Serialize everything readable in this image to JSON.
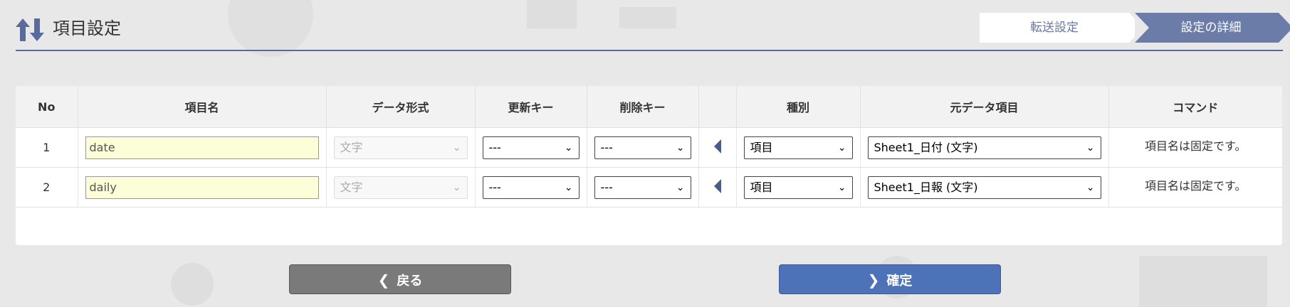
{
  "header": {
    "title": "項目設定",
    "steps": [
      "転送設定",
      "設定の詳細"
    ]
  },
  "table": {
    "columns": [
      "No",
      "項目名",
      "データ形式",
      "更新キー",
      "削除キー",
      "",
      "種別",
      "元データ項目",
      "コマンド"
    ],
    "rows": [
      {
        "no": "1",
        "name": "date",
        "format": "文字",
        "update_key": "---",
        "delete_key": "---",
        "kind": "項目",
        "source": "Sheet1_日付 (文字)",
        "command": "項目名は固定です。"
      },
      {
        "no": "2",
        "name": "daily",
        "format": "文字",
        "update_key": "---",
        "delete_key": "---",
        "kind": "項目",
        "source": "Sheet1_日報 (文字)",
        "command": "項目名は固定です。"
      }
    ]
  },
  "buttons": {
    "back": "戻る",
    "confirm": "確定"
  },
  "colors": {
    "accent": "#6c7ca8",
    "confirm": "#4e72b8",
    "back": "#7a7a7a",
    "input_bg": "#fdfdd8"
  },
  "icons": {
    "title": "sort-arrows-icon",
    "back": "chevron-left-icon",
    "confirm": "chevron-right-icon",
    "row_pointer": "triangle-left-icon"
  }
}
